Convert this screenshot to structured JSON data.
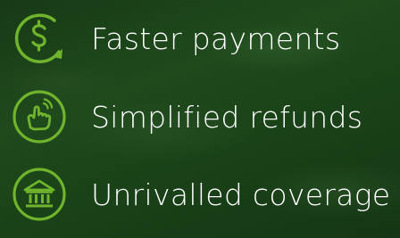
{
  "features": [
    {
      "icon": "dollar-cycle-icon",
      "label": "Faster payments"
    },
    {
      "icon": "hand-tap-icon",
      "label": "Simplified refunds"
    },
    {
      "icon": "bank-icon",
      "label": "Unrivalled coverage"
    }
  ],
  "colors": {
    "accent": "#6fb42c",
    "text": "#ffffff",
    "background": "#1f4a1c"
  }
}
